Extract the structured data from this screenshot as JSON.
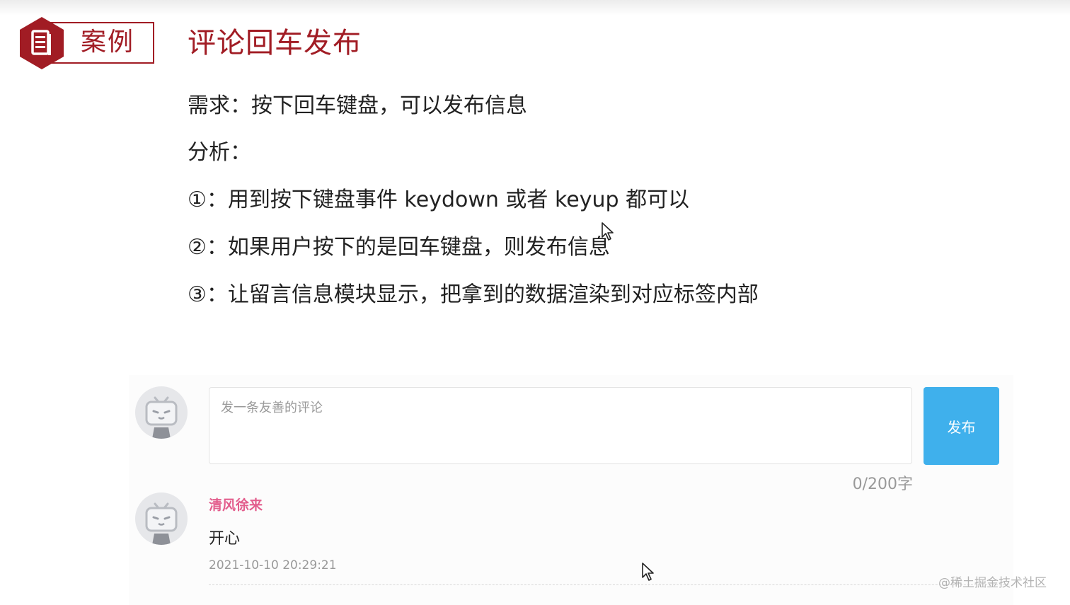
{
  "header": {
    "badge_label": "案例",
    "title": "评论回车发布"
  },
  "content": {
    "requirement": "需求：按下回车键盘，可以发布信息",
    "analysis": "分析：",
    "step1": "①：用到按下键盘事件 keydown 或者 keyup 都可以",
    "step2": "②：如果用户按下的是回车键盘，则发布信息",
    "step3": "③：让留言信息模块显示，把拿到的数据渲染到对应标签内部"
  },
  "comment_box": {
    "placeholder": "发一条友善的评论",
    "publish_label": "发布",
    "counter": "0/200字"
  },
  "comment": {
    "username": "清风徐来",
    "text": "开心",
    "time": "2021-10-10 20:29:21"
  },
  "watermark": "@稀土掘金技术社区",
  "colors": {
    "accent": "#a11c24",
    "button": "#3fb0ec",
    "username": "#e35e8d"
  }
}
